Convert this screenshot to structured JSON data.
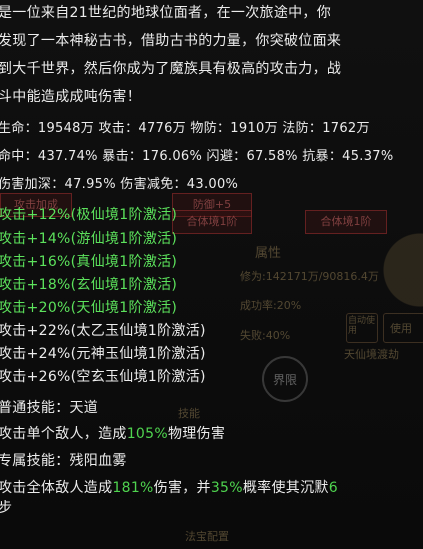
{
  "intro": [
    "是一位来自21世纪的地球位面者，在一次旅途中，你",
    "发现了一本神秘古书，借助古书的力量，你突破位面来",
    "到大千世界，然后你成为了魔族具有极高的攻击力，战",
    "斗中能造成成吨伤害！"
  ],
  "stats": [
    "生命：19548万 攻击：4776万   物防：1910万  法防：1762万",
    "命中：437.74% 暴击：176.06% 闪避：67.58%  抗暴：45.37%",
    "伤害加深：47.95%     伤害减免：43.00%"
  ],
  "bonuses_green": [
    "攻击+12%(极仙境1阶激活)",
    "攻击+14%(游仙境1阶激活)",
    "攻击+16%(真仙境1阶激活)",
    "攻击+18%(玄仙境1阶激活)",
    "攻击+20%(天仙境1阶激活)"
  ],
  "bonuses_gray": [
    "攻击+22%(太乙玉仙境1阶激活)",
    "攻击+24%(元神玉仙境1阶激活)",
    "攻击+26%(空玄玉仙境1阶激活)"
  ],
  "skills": {
    "normal_title": "普通技能：天道",
    "normal_desc_pre": "攻击单个敌人，造成",
    "normal_pct": "105%",
    "normal_desc_post": "物理伤害",
    "special_title": "专属技能：残阳血雾",
    "special_desc_pre": "攻击全体敌人造成",
    "special_pct1": "181%",
    "special_desc_mid": "伤害，并",
    "special_pct2": "35%",
    "special_desc_mid2": "概率使其沉默",
    "special_turns": "6",
    "special_desc_end": "步"
  },
  "background": {
    "tabs": [
      "攻击加成",
      "防御+5",
      "合体境1阶",
      "合体境1阶"
    ],
    "attr_title": "属性",
    "cultivation": "修为:142171万/90816.4万",
    "bonus_rate": "成功率:20%",
    "fail_rate": "失败:40%",
    "auto_label": "自动使用",
    "use_label": "使用",
    "realm_label": "天仙境渡劫",
    "circle_labels": [
      "界限"
    ],
    "bottom_labels": [
      "技能",
      "法宝配置"
    ],
    "colors": {
      "green": "#5ce25c",
      "text": "#ececec",
      "bg": "#0b0b0b"
    }
  }
}
